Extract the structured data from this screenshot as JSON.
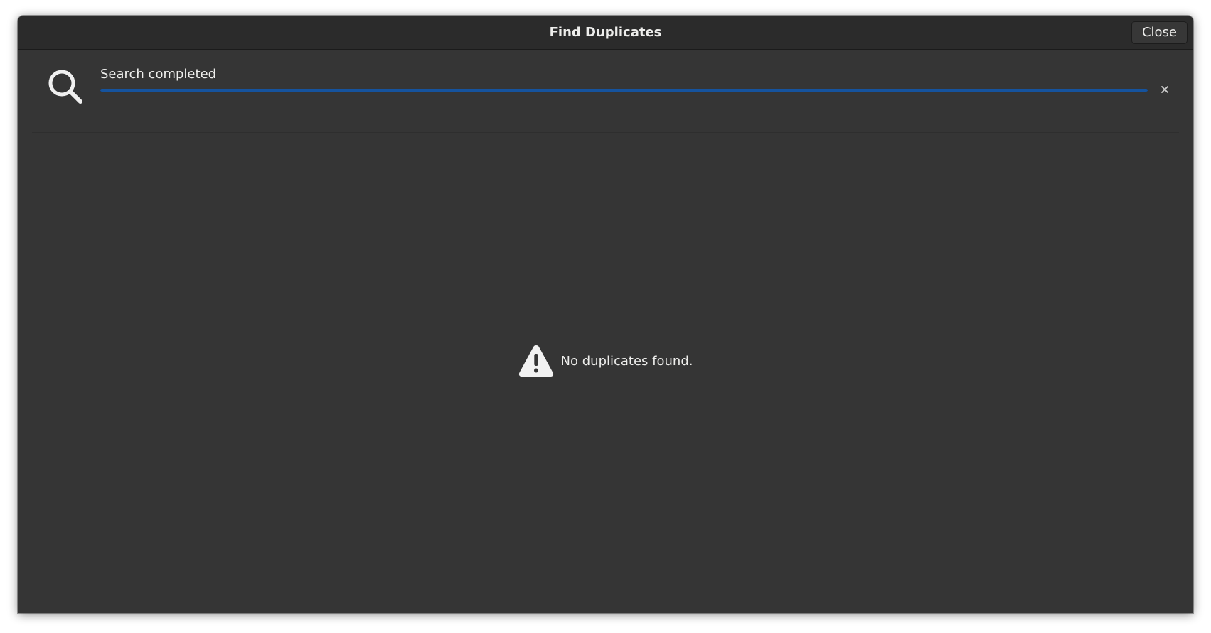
{
  "dialog": {
    "title": "Find Duplicates",
    "close_label": "Close"
  },
  "search": {
    "status_text": "Search completed",
    "progress_percent": 100,
    "icon": "search-icon",
    "cancel_icon": "close-icon"
  },
  "results": {
    "empty_message": "No duplicates found.",
    "icon": "warning-icon"
  },
  "colors": {
    "accent": "#15539e",
    "background": "#353535",
    "titlebar": "#2b2b2b",
    "text": "#eeeeec"
  }
}
